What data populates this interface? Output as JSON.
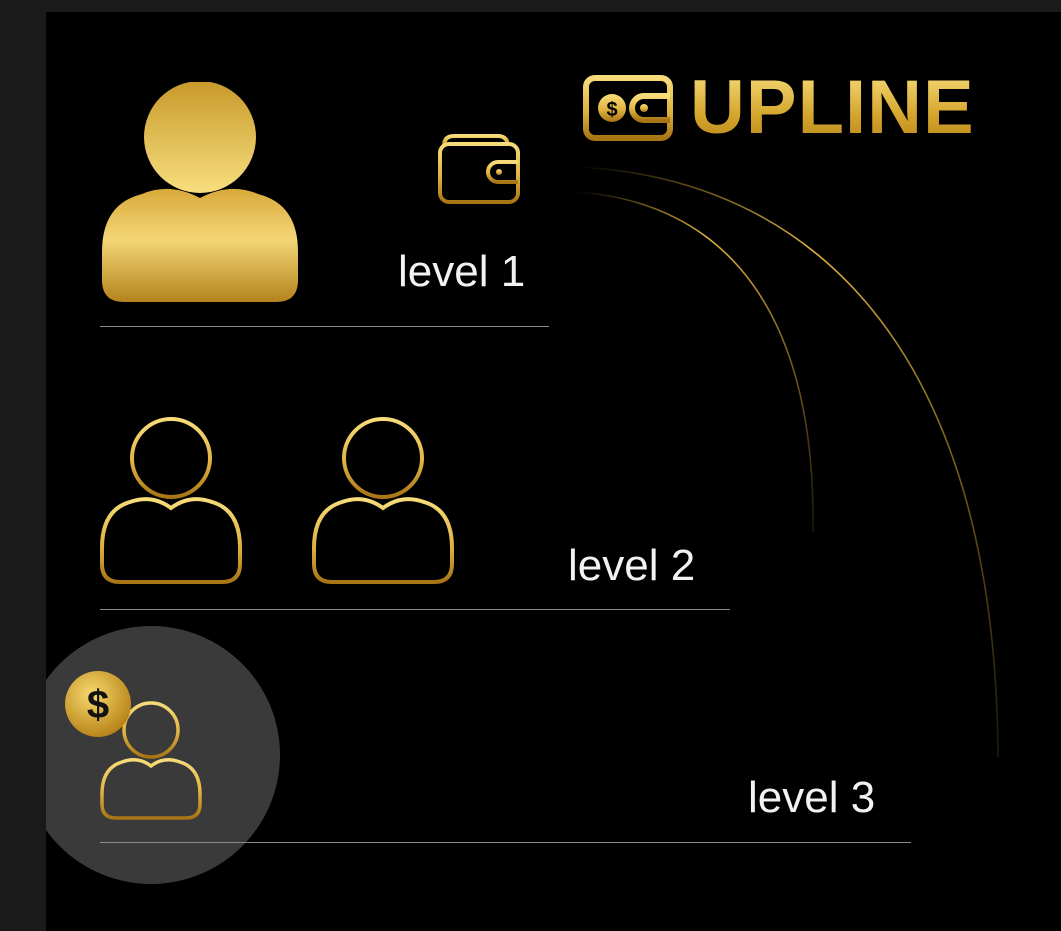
{
  "brand": {
    "title": "UPLINE",
    "icon": "wallet-dollar-icon"
  },
  "levels": [
    {
      "label": "level 1",
      "members": 1,
      "style": "filled"
    },
    {
      "label": "level 2",
      "members": 2,
      "style": "outline"
    },
    {
      "label": "level 3",
      "members": 1,
      "style": "outline-highlighted"
    }
  ],
  "icons": {
    "level1_wallet": "wallet-icon",
    "level3_coin": "dollar-coin-icon"
  },
  "colors": {
    "gold_light": "#f7dc7a",
    "gold_mid": "#d4a52c",
    "gold_dark": "#a87515",
    "background": "#000000",
    "frame": "#1a1a1a",
    "text": "#f2f2f2",
    "divider": "#8a8a8a",
    "highlight": "#3a3a3a"
  }
}
